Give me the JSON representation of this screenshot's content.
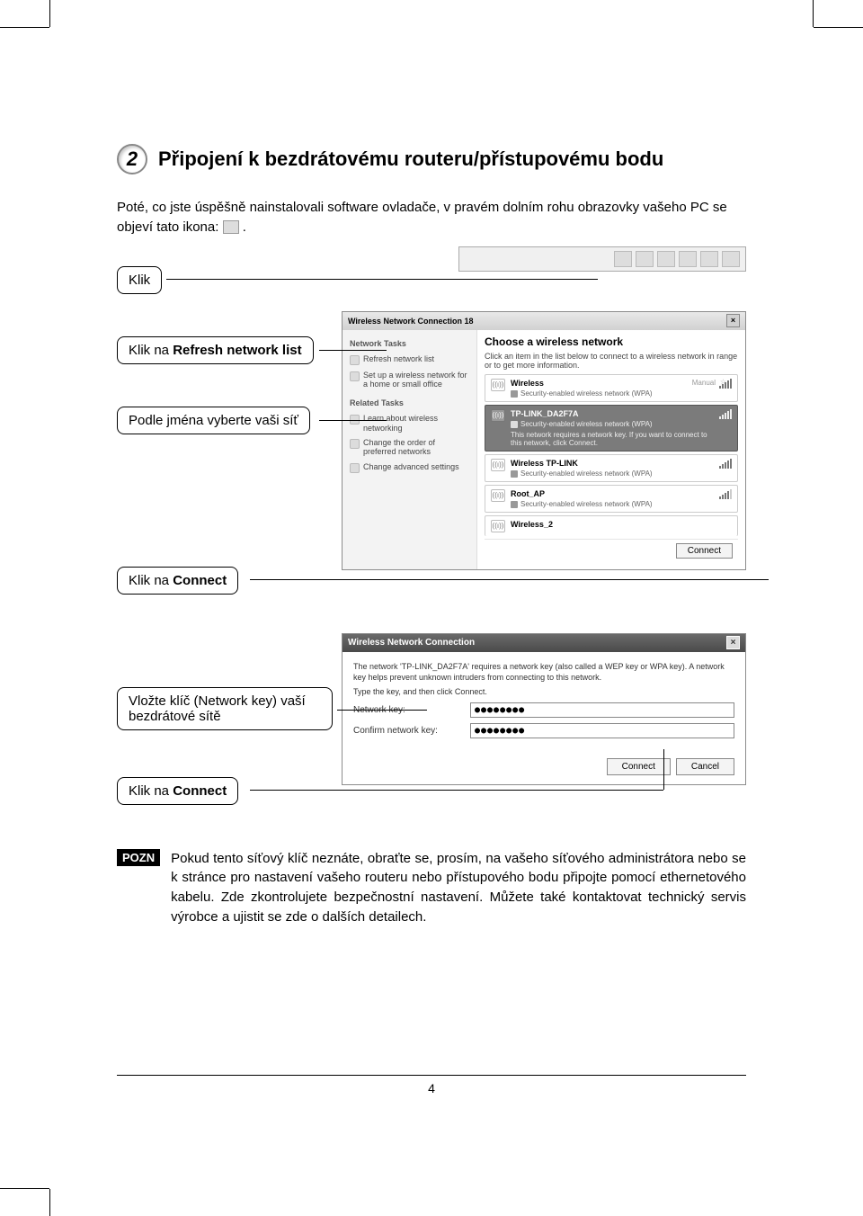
{
  "step": {
    "number": "2",
    "title": "Připojení k bezdrátovému routeru/přístupovému bodu"
  },
  "intro": "Poté, co jste úspěšně nainstalovali software ovladače, v pravém dolním rohu obrazovky vašeho PC se objeví tato ikona:   ",
  "tray_icon_placeholder": " ",
  "callouts": {
    "click": "Klik",
    "refresh": "Klik na ",
    "refresh_bold": "Refresh network list",
    "select": "Podle jména vyberte vaši síť",
    "connect1": "Klik na ",
    "connect1_bold": "Connect",
    "key": "Vložte klíč (Network key) vaší bezdrátové sítě",
    "connect2": "Klik na ",
    "connect2_bold": "Connect"
  },
  "wnc": {
    "title": "Wireless Network Connection 18",
    "left": {
      "network_tasks": "Network Tasks",
      "refresh": "Refresh network list",
      "setup": "Set up a wireless network for a home or small office",
      "related_tasks": "Related Tasks",
      "learn": "Learn about wireless networking",
      "order": "Change the order of preferred networks",
      "advanced": "Change advanced settings"
    },
    "right": {
      "heading": "Choose a wireless network",
      "sub": "Click an item in the list below to connect to a wireless network in range or to get more information.",
      "networks": [
        {
          "name": "Wireless",
          "detail": "Security-enabled wireless network (WPA)",
          "manual": "Manual",
          "star": "☆"
        },
        {
          "name": "TP-LINK_DA2F7A",
          "detail": "Security-enabled wireless network (WPA)",
          "extra": "This network requires a network key. If you want to connect to this network, click Connect.",
          "selected": true
        },
        {
          "name": "Wireless TP-LINK",
          "detail": "Security-enabled wireless network (WPA)"
        },
        {
          "name": "Root_AP",
          "detail": "Security-enabled wireless network (WPA)"
        },
        {
          "name": "Wireless_2",
          "detail": ""
        }
      ],
      "connect": "Connect"
    }
  },
  "key_dialog": {
    "title": "Wireless Network Connection",
    "text1": "The network 'TP-LINK_DA2F7A' requires a network key (also called a WEP key or WPA key). A network key helps prevent unknown intruders from connecting to this network.",
    "text2": "Type the key, and then click Connect.",
    "label1": "Network key:",
    "label2": "Confirm network key:",
    "mask": "●●●●●●●●",
    "connect": "Connect",
    "cancel": "Cancel"
  },
  "note": {
    "badge": "POZN",
    "text": "Pokud tento síťový klíč neznáte, obraťte se, prosím, na vašeho síťového administrátora nebo se k stránce pro nastavení vašeho routeru nebo přístupového bodu připojte pomocí ethernetového kabelu. Zde zkontrolujete bezpečnostní nastavení. Můžete také kontaktovat technický servis výrobce a ujistit se zde o dalších detailech."
  },
  "page_number": "4"
}
